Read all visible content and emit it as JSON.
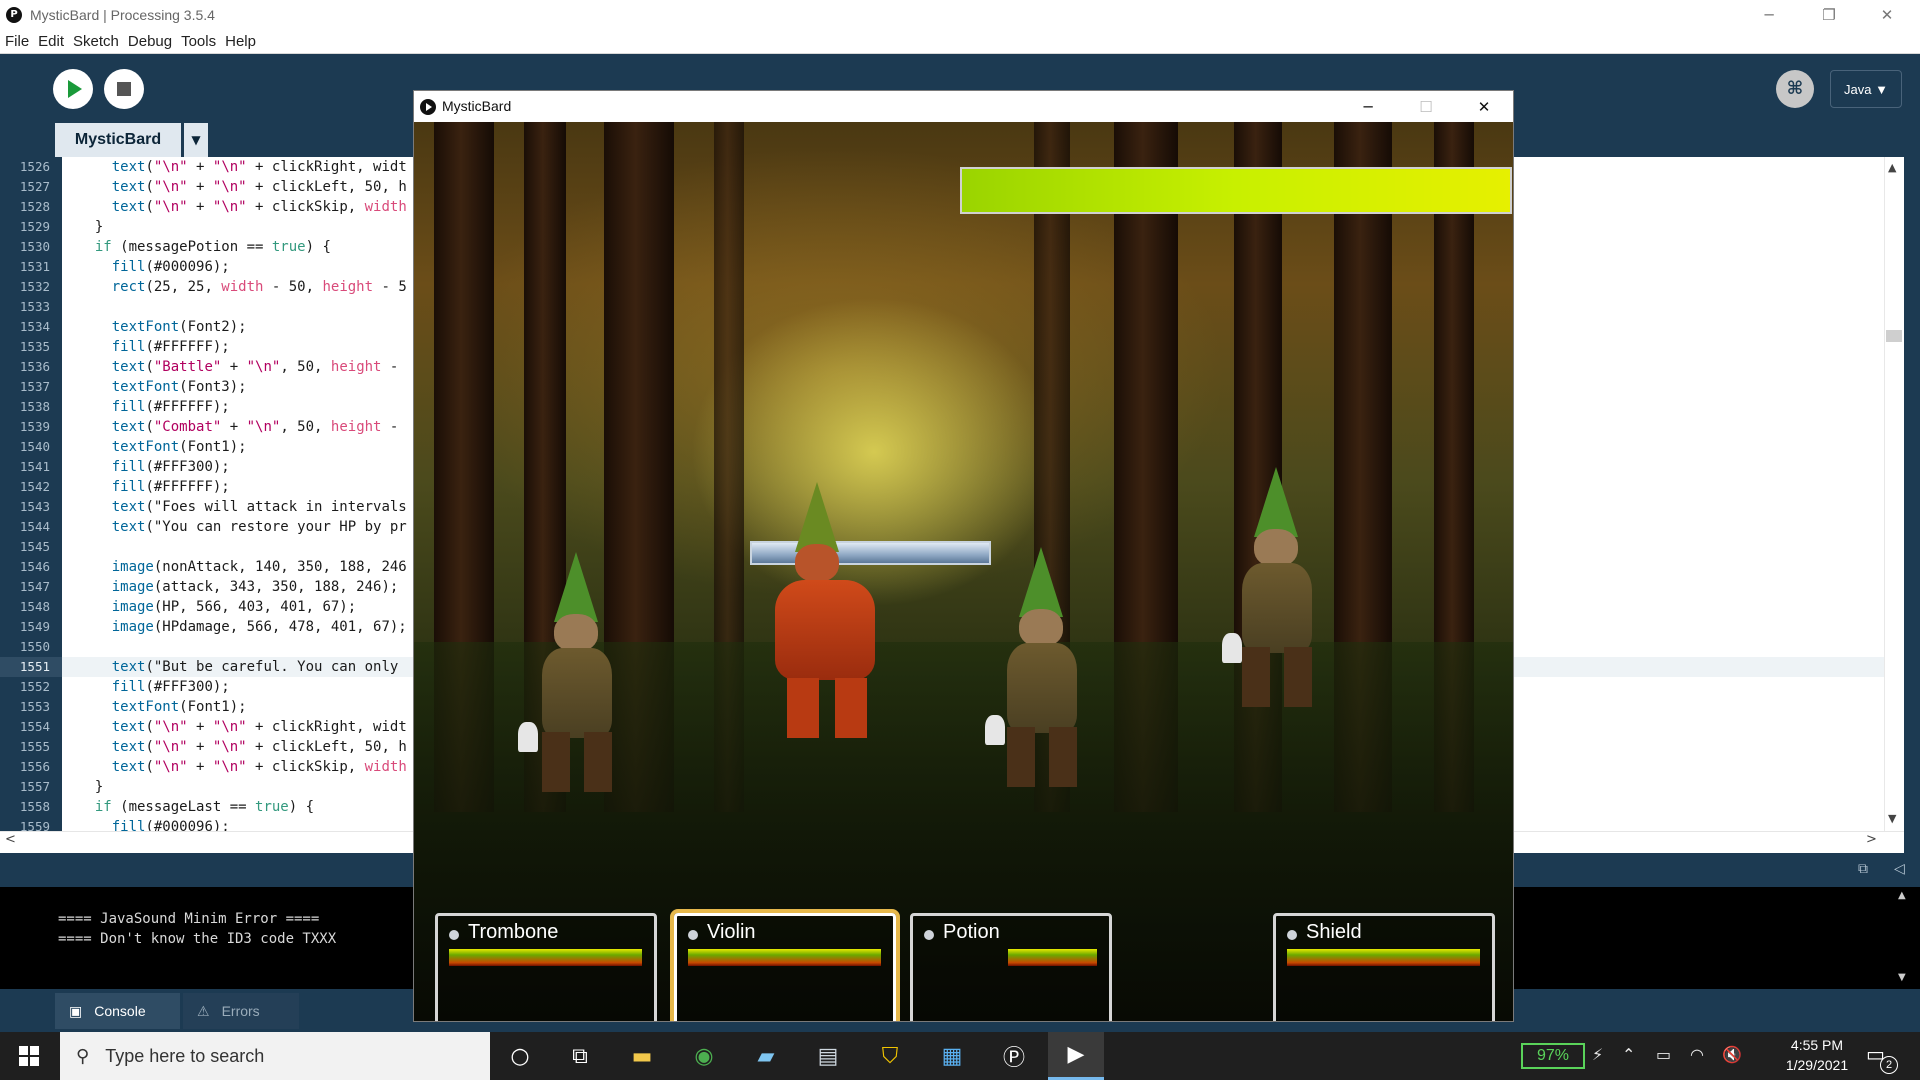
{
  "window": {
    "title": "MysticBard | Processing 3.5.4",
    "minimize": "─",
    "maximize": "❐",
    "close": "✕"
  },
  "menu": [
    "File",
    "Edit",
    "Sketch",
    "Debug",
    "Tools",
    "Help"
  ],
  "toolbar": {
    "mode": "Java ▼",
    "sketch_tab": "MysticBard",
    "tab_menu": "▼"
  },
  "editor": {
    "line_numbers": [
      "1526",
      "1527",
      "1528",
      "1529",
      "1530",
      "1531",
      "1532",
      "1533",
      "1534",
      "1535",
      "1536",
      "1537",
      "1538",
      "1539",
      "1540",
      "1541",
      "1542",
      "1543",
      "1544",
      "1545",
      "1546",
      "1547",
      "1548",
      "1549",
      "1550",
      "1551",
      "1552",
      "1553",
      "1554",
      "1555",
      "1556",
      "1557",
      "1558",
      "1559"
    ],
    "current_line": "1551",
    "lines": [
      "    text(\"\\n\" + \"\\n\" + clickRight, widt",
      "    text(\"\\n\" + \"\\n\" + clickLeft, 50, h",
      "    text(\"\\n\" + \"\\n\" + clickSkip, width",
      "  }",
      "  if (messagePotion == true) {",
      "    fill(#000096);",
      "    rect(25, 25, width - 50, height - 5",
      "",
      "    textFont(Font2);",
      "    fill(#FFFFFF);",
      "    text(\"Battle\" + \"\\n\", 50, height -",
      "    textFont(Font3);",
      "    fill(#FFFFFF);",
      "    text(\"Combat\" + \"\\n\", 50, height -",
      "    textFont(Font1);",
      "    fill(#FFF300);",
      "    fill(#FFFFFF);",
      "    text(\"Foes will attack in intervals",
      "    text(\"You can restore your HP by pr",
      "",
      "    image(nonAttack, 140, 350, 188, 246",
      "    image(attack, 343, 350, 188, 246);",
      "    image(HP, 566, 403, 401, 67);",
      "    image(HPdamage, 566, 478, 401, 67);",
      "",
      "    text(\"But be careful. You can only",
      "    fill(#FFF300);",
      "    textFont(Font1);",
      "    text(\"\\n\" + \"\\n\" + clickRight, widt",
      "    text(\"\\n\" + \"\\n\" + clickLeft, 50, h",
      "    text(\"\\n\" + \"\\n\" + clickSkip, width",
      "  }",
      "  if (messageLast == true) {",
      "    fill(#000096);"
    ]
  },
  "console": {
    "lines": [
      "==== JavaSound Minim Error ====",
      "==== Don't know the ID3 code TXXX"
    ],
    "tabs": {
      "console": "Console",
      "errors": "Errors"
    }
  },
  "sketch": {
    "title": "MysticBard",
    "enemy_hp_fraction": 1.0,
    "slots": [
      {
        "label": "Trombone",
        "selected": false
      },
      {
        "label": "Violin",
        "selected": true
      },
      {
        "label": "Potion",
        "selected": false
      },
      {
        "label": "Shield",
        "selected": false
      }
    ]
  },
  "taskbar": {
    "search_placeholder": "Type here to search",
    "battery": "97%",
    "time": "4:55 PM",
    "date": "1/29/2021",
    "notifications": "2",
    "apps": [
      "cortana-icon",
      "task-view-icon",
      "file-explorer-icon",
      "chrome-icon",
      "notepad-icon",
      "wordpad-icon",
      "norton-icon",
      "photos-icon",
      "processing-icon",
      "sketch-run-icon"
    ]
  },
  "colors": {
    "ide_bg": "#1c3a52",
    "accent_selected": "#e6b84b",
    "enemy_hp": "#c8f000"
  }
}
